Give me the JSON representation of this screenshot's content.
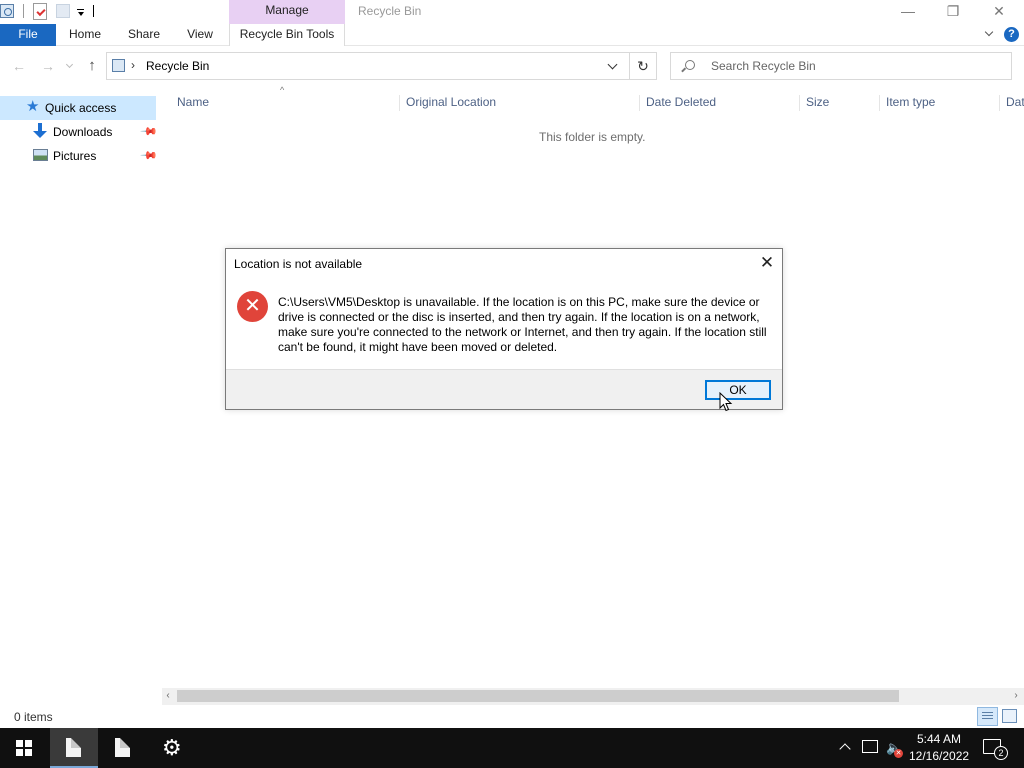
{
  "window": {
    "title": "Recycle Bin",
    "context_group": "Manage",
    "controls": {
      "minimize": "—",
      "maximize": "❐",
      "close": "✕"
    }
  },
  "ribbon": {
    "tabs": [
      {
        "label": "File",
        "active": true
      },
      {
        "label": "Home"
      },
      {
        "label": "Share"
      },
      {
        "label": "View"
      },
      {
        "label": "Recycle Bin Tools"
      }
    ],
    "help_label": "?"
  },
  "address": {
    "path": "Recycle Bin",
    "chevron": "›",
    "refresh": "↻",
    "back": "←",
    "forward": "→",
    "up": "↑"
  },
  "search": {
    "placeholder": "Search Recycle Bin"
  },
  "sidebar": {
    "items": [
      {
        "label": "Quick access",
        "icon": "star-icon",
        "selected": true
      },
      {
        "label": "Downloads",
        "icon": "download-icon",
        "pinned": true
      },
      {
        "label": "Pictures",
        "icon": "pictures-icon",
        "pinned": true
      }
    ],
    "pin_glyph": "📌"
  },
  "columns": [
    "Name",
    "Original Location",
    "Date Deleted",
    "Size",
    "Item type",
    "Dat"
  ],
  "sort_glyph": "^",
  "empty_message": "This folder is empty.",
  "scrollbar": {
    "left": "‹",
    "right": "›"
  },
  "status": {
    "item_count": "0 items"
  },
  "dialog": {
    "title": "Location is not available",
    "close_glyph": "✕",
    "error_glyph": "✕",
    "message": "C:\\Users\\VM5\\Desktop is unavailable. If the location is on this PC, make sure the device or drive is connected or the disc is inserted, and then try again. If the location is on a network, make sure you're connected to the network or Internet, and then try again. If the location still can't be found, it might have been moved or deleted.",
    "ok_label": "OK"
  },
  "taskbar": {
    "gear_glyph": "⚙",
    "volume_glyph": "🔈",
    "mute_glyph": "✕",
    "clock": {
      "time": "5:44 AM",
      "date": "12/16/2022"
    },
    "notification_count": "2"
  },
  "colors": {
    "accent": "#1a68c1",
    "manage_tab": "#e8d0f3",
    "selection": "#cce8ff",
    "error": "#e0443a",
    "taskbar": "#101010"
  }
}
